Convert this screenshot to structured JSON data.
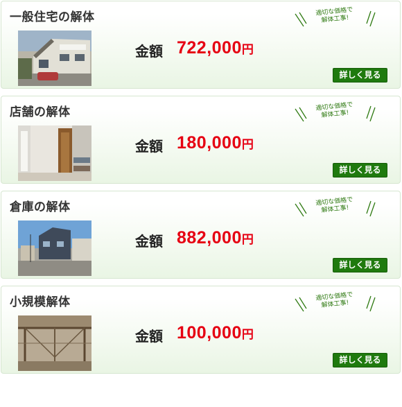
{
  "common": {
    "price_label": "金額",
    "price_unit": "円",
    "tagline_line1": "適切な価格で",
    "tagline_line2": "解体工事!",
    "detail_button": "詳しく見る"
  },
  "cards": [
    {
      "title": "一般住宅の解体",
      "price": "722,000"
    },
    {
      "title": "店舗の解体",
      "price": "180,000"
    },
    {
      "title": "倉庫の解体",
      "price": "882,000"
    },
    {
      "title": "小規模解体",
      "price": "100,000"
    }
  ],
  "colors": {
    "price": "#e60012",
    "button": "#1f7a0e",
    "tagline": "#2f7a12"
  }
}
